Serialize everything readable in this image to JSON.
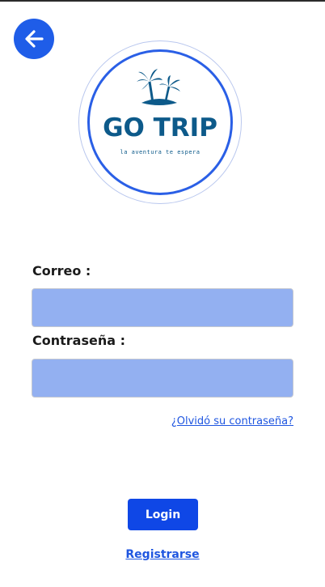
{
  "colors": {
    "primary": "#0f47e6",
    "back_button": "#1f5de8",
    "input_fill": "#93b0f1",
    "link": "#1f56e0",
    "logo_text": "#0d5a8a",
    "logo_ring": "#2a5fe6"
  },
  "icons": {
    "back": "arrow-left-icon",
    "logo": "palm-island-icon"
  },
  "logo": {
    "title": "GO TRIP",
    "tagline": "la aventura te espera"
  },
  "form": {
    "email_label": "Correo :",
    "email_value": "",
    "password_label": "Contraseña :",
    "password_value": "",
    "forgot_link": "¿Olvidó su contraseña?",
    "login_button": "Login",
    "register_link": "Registrarse"
  }
}
